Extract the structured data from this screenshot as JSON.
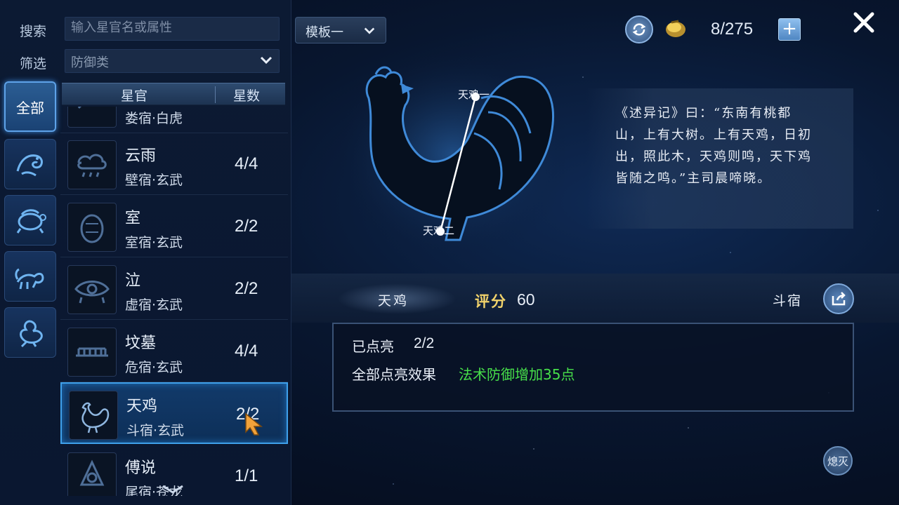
{
  "search": {
    "label": "搜索",
    "placeholder": "输入星官名或属性"
  },
  "filter": {
    "label": "筛选",
    "value": "防御类"
  },
  "categories": [
    {
      "label": "全部",
      "active": true
    },
    {
      "icon": "dragon-emblem-icon"
    },
    {
      "icon": "turtle-emblem-icon"
    },
    {
      "icon": "tiger-emblem-icon"
    },
    {
      "icon": "phoenix-emblem-icon"
    }
  ],
  "list_header": {
    "col_name": "星官",
    "col_count": "星数"
  },
  "list": [
    {
      "name": "",
      "sub": "娄宿·白虎",
      "count": "",
      "icon": "tiger-constellation-icon"
    },
    {
      "name": "云雨",
      "sub": "壁宿·玄武",
      "count": "4/4",
      "icon": "cloud-rain-icon"
    },
    {
      "name": "室",
      "sub": "室宿·玄武",
      "count": "2/2",
      "icon": "chamber-icon"
    },
    {
      "name": "泣",
      "sub": "虚宿·玄武",
      "count": "2/2",
      "icon": "weeping-eye-icon"
    },
    {
      "name": "坟墓",
      "sub": "危宿·玄武",
      "count": "4/4",
      "icon": "tomb-icon"
    },
    {
      "name": "天鸡",
      "sub": "斗宿·玄武",
      "count": "2/2",
      "icon": "rooster-icon",
      "selected": true
    },
    {
      "name": "傅说",
      "sub": "尾宿·苍龙",
      "count": "1/1",
      "icon": "sage-icon"
    }
  ],
  "topbar": {
    "template_label": "模板一",
    "counter": "8/275",
    "add_label": "+"
  },
  "constellation": {
    "star_labels": [
      "天鸡一",
      "天鸡二"
    ],
    "poem": "《述异记》曰：“东南有桃都山，上有大树。上有天鸡，日初出，照此木，天鸡则鸣，天下鸡皆随之鸣。”主司晨啼晓。"
  },
  "detail": {
    "name": "天鸡",
    "score_label": "评分",
    "score_value": "60",
    "mansion": "斗宿",
    "lit_label": "已点亮",
    "lit_value": "2/2",
    "effect_label": "全部点亮效果",
    "effect_value": "法术防御增加35点",
    "extinguish_label": "熄灭"
  },
  "colors": {
    "accent": "#3fa0ea",
    "effect_green": "#47e04a",
    "score_gold": "#f2d36b"
  }
}
